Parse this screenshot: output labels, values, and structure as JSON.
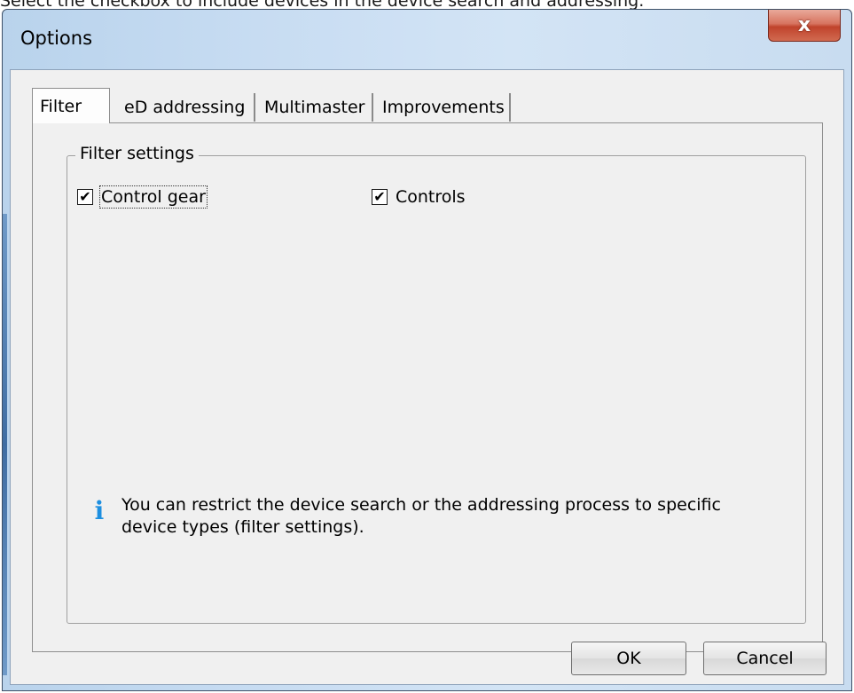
{
  "caption": "Select the checkbox to include devices in the device search and addressing.",
  "window": {
    "title": "Options",
    "close_glyph": "x"
  },
  "tabs": [
    {
      "label": "Filter",
      "active": true
    },
    {
      "label": "eD addressing",
      "active": false
    },
    {
      "label": "Multimaster",
      "active": false
    },
    {
      "label": "Improvements",
      "active": false
    }
  ],
  "filter": {
    "group_title": "Filter settings",
    "checkboxes": [
      {
        "label": "Control gear",
        "checked": true,
        "mark": "✔"
      },
      {
        "label": "Controls",
        "checked": true,
        "mark": "✔"
      }
    ],
    "info_icon": "info-icon",
    "info_text": "You can restrict the device search or the addressing process to specific device types (filter settings)."
  },
  "buttons": {
    "ok": "OK",
    "cancel": "Cancel"
  },
  "colors": {
    "title_bar": "#c7dcf2",
    "close_button": "#c0432c",
    "info_icon": "#1d8fe0",
    "client_bg": "#f0f0f0"
  }
}
